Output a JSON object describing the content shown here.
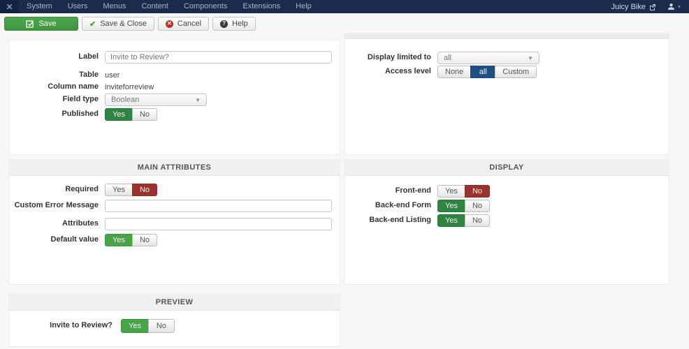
{
  "navbar": {
    "items": [
      "System",
      "Users",
      "Menus",
      "Content",
      "Components",
      "Extensions",
      "Help"
    ],
    "site_name": "Juicy Bike"
  },
  "toolbar": {
    "save": "Save",
    "save_close": "Save & Close",
    "cancel": "Cancel",
    "help": "Help",
    "cancel_icon_glyph": "✕",
    "help_icon_glyph": "?",
    "check_glyph": "✔"
  },
  "general": {
    "label_field": {
      "label": "Label",
      "value": "Invite to Review?"
    },
    "table_field": {
      "label": "Table",
      "value": "user"
    },
    "column_field": {
      "label": "Column name",
      "value": "inviteforreview"
    },
    "field_type": {
      "label": "Field type",
      "value": "Boolean"
    },
    "published": {
      "label": "Published",
      "options": [
        "Yes",
        "No"
      ],
      "selected": "Yes"
    },
    "display_limited": {
      "label": "Display limited to",
      "value": "all"
    },
    "access_level": {
      "label": "Access level",
      "options": [
        "None",
        "all",
        "Custom"
      ],
      "selected": "all"
    }
  },
  "main_attributes": {
    "title": "MAIN ATTRIBUTES",
    "required": {
      "label": "Required",
      "options": [
        "Yes",
        "No"
      ],
      "selected": "No"
    },
    "custom_error_message": {
      "label": "Custom Error Message",
      "value": ""
    },
    "attributes": {
      "label": "Attributes",
      "value": ""
    },
    "default_value": {
      "label": "Default value",
      "options": [
        "Yes",
        "No"
      ],
      "selected": "Yes"
    }
  },
  "display_panel": {
    "title": "DISPLAY",
    "front_end": {
      "label": "Front-end",
      "options": [
        "Yes",
        "No"
      ],
      "selected": "No"
    },
    "back_end_form": {
      "label": "Back-end Form",
      "options": [
        "Yes",
        "No"
      ],
      "selected": "Yes"
    },
    "back_end_listing": {
      "label": "Back-end Listing",
      "options": [
        "Yes",
        "No"
      ],
      "selected": "Yes"
    }
  },
  "preview": {
    "title": "PREVIEW",
    "field": {
      "label": "Invite to Review?",
      "options": [
        "Yes",
        "No"
      ],
      "selected": "Yes"
    }
  },
  "colors": {
    "navbar_bg": "#1a2b4c",
    "save_green": "#46a546",
    "toggle_green_dark": "#2e8540",
    "toggle_green_light": "#47a447",
    "toggle_red": "#9d312b",
    "toggle_blue": "#1e5086",
    "panel_header_bg": "#f0f0f0",
    "page_bg": "#f7f7f7"
  }
}
